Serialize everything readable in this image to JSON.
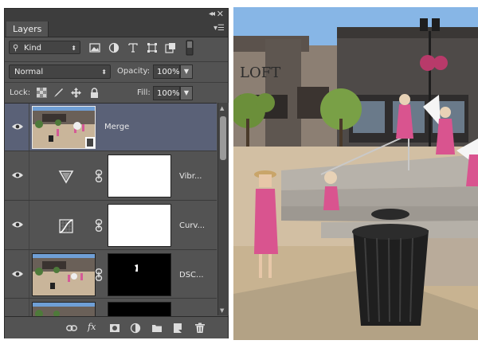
{
  "layers_panel": {
    "tab_label": "Layers",
    "collapse_glyph": "◂◂",
    "close_glyph": "✕",
    "panel_menu_glyph": "▾☰",
    "filter": {
      "kind_label": "Kind",
      "filter_icons": [
        "image-filter-icon",
        "adjustment-filter-icon",
        "type-filter-icon",
        "shape-filter-icon",
        "smart-object-filter-icon",
        "filter-toggle-switch-icon"
      ]
    },
    "blend_mode": "Normal",
    "opacity_label": "Opacity:",
    "opacity_value": "100%",
    "lock_label": "Lock:",
    "lock_icons": [
      "lock-transparent-pixels-icon",
      "lock-image-pixels-icon",
      "lock-position-icon",
      "lock-all-icon"
    ],
    "fill_label": "Fill:",
    "fill_value": "100%",
    "layers": [
      {
        "name": "Merge",
        "visible": true,
        "selected": true,
        "type": "pixel"
      },
      {
        "name": "Vibr...",
        "visible": true,
        "selected": false,
        "type": "adjustment",
        "icon": "vibrance-icon"
      },
      {
        "name": "Curv...",
        "visible": true,
        "selected": false,
        "type": "adjustment",
        "icon": "curves-icon"
      },
      {
        "name": "DSC...",
        "visible": true,
        "selected": false,
        "type": "pixel-with-mask"
      },
      {
        "name": "",
        "visible": true,
        "selected": false,
        "type": "pixel-with-mask"
      }
    ],
    "bottom_icons": [
      "link-layers-icon",
      "layer-style-fx-icon",
      "add-mask-icon",
      "new-adjustment-layer-icon",
      "new-group-folder-icon",
      "new-layer-icon",
      "delete-trash-icon"
    ],
    "fx_label": "fx"
  },
  "colors": {
    "panel_bg": "#535353",
    "selected_row": "#5a6177",
    "dark_chrome": "#3d3d3d"
  }
}
